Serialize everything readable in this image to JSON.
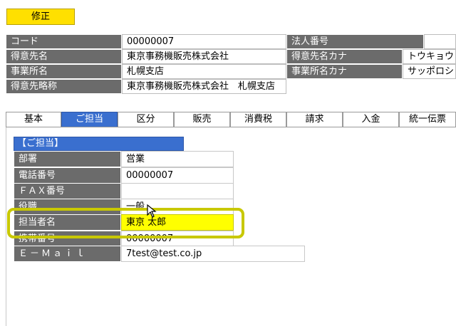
{
  "toolbar": {
    "modify_label": "修正"
  },
  "header": {
    "rows": [
      {
        "label": "コード",
        "value": "00000007",
        "label2": "法人番号",
        "value2": ""
      },
      {
        "label": "得意先名",
        "value": "東京事務機販売株式会社",
        "label2": "得意先名カナ",
        "value2": "トウキョウ"
      },
      {
        "label": "事業所名",
        "value": "札幌支店",
        "label2": "事業所名カナ",
        "value2": "サッポロシ"
      },
      {
        "label": "得意先略称",
        "value": "東京事務機販売株式会社　札幌支店"
      }
    ]
  },
  "tabs": [
    {
      "label": "基本"
    },
    {
      "label": "ご担当"
    },
    {
      "label": "区分"
    },
    {
      "label": "販売"
    },
    {
      "label": "消費税"
    },
    {
      "label": "請求"
    },
    {
      "label": "入金"
    },
    {
      "label": "統一伝票"
    }
  ],
  "active_tab": "ご担当",
  "panel": {
    "section_title": "【ご担当】",
    "fields": [
      {
        "label": "部署",
        "value": "営業"
      },
      {
        "label": "電話番号",
        "value": "00000007"
      },
      {
        "label": "ＦＡＸ番号",
        "value": ""
      },
      {
        "label": "役職",
        "value": "一般"
      },
      {
        "label": "担当者名",
        "value": "東京 太郎"
      },
      {
        "label": "携帯番号",
        "value": "00000007"
      },
      {
        "label": "Ｅ－Ｍａｉｌ",
        "value": "7test@test.co.jp"
      }
    ]
  },
  "colors": {
    "label_bg": "#6b6b6b",
    "accent_blue": "#3a6fcf",
    "modify_button": "#ffe000",
    "highlight_field": "#ffff00",
    "highlight_frame": "#c8c800"
  },
  "icons": {
    "cursor": "mouse-pointer-icon"
  }
}
